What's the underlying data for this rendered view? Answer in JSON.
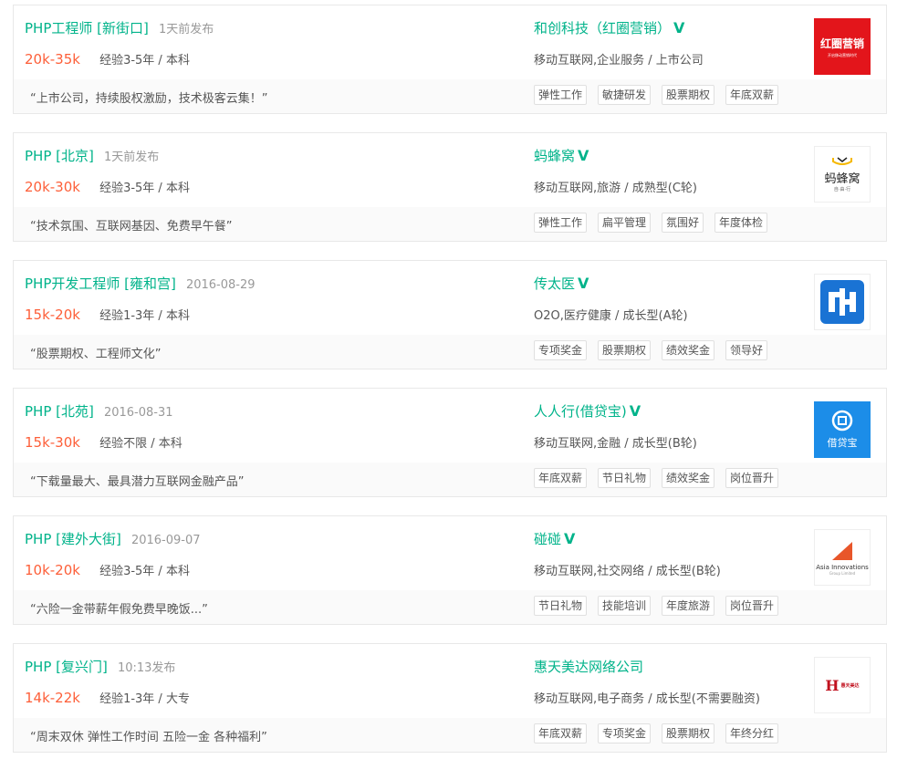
{
  "jobs": [
    {
      "position": "PHP工程师 [新街口]",
      "time": "1天前发布",
      "salary": "20k-35k",
      "requirement": "经验3-5年 / 本科",
      "company": "和创科技（红圈营销）",
      "industry": "移动互联网,企业服务 / 上市公司",
      "slogan": "“上市公司，持续股权激励，技术极客云集！”",
      "tags": [
        "弹性工作",
        "敏捷研发",
        "股票期权",
        "年底双薪"
      ],
      "logo": {
        "text": "红圈营销",
        "subtext": "开启移动营销时代",
        "icon": "hongquan-logo-icon"
      }
    },
    {
      "position": "PHP [北京]",
      "time": "1天前发布",
      "salary": "20k-30k",
      "requirement": "经验3-5年 / 本科",
      "company": "蚂蜂窝",
      "industry": "移动互联网,旅游 / 成熟型(C轮)",
      "slogan": "“技术氛围、互联网基因、免费早午餐”",
      "tags": [
        "弹性工作",
        "扁平管理",
        "氛围好",
        "年度体检"
      ],
      "logo": {
        "text": "蚂蜂窝",
        "subtext": "自·由·行",
        "icon": "mafengwo-logo-icon"
      }
    },
    {
      "position": "PHP开发工程师 [雍和宫]",
      "time": "2016-08-29",
      "salary": "15k-20k",
      "requirement": "经验1-3年 / 本科",
      "company": "传太医",
      "industry": "O2O,医疗健康 / 成长型(A轮)",
      "slogan": "“股票期权、工程师文化”",
      "tags": [
        "专项奖金",
        "股票期权",
        "绩效奖金",
        "领导好"
      ],
      "logo": {
        "text": "",
        "subtext": "",
        "icon": "chuantaiyi-logo-icon"
      }
    },
    {
      "position": "PHP [北苑]",
      "time": "2016-08-31",
      "salary": "15k-30k",
      "requirement": "经验不限 / 本科",
      "company": "人人行(借贷宝)",
      "industry": "移动互联网,金融 / 成长型(B轮)",
      "slogan": "“下载量最大、最具潜力互联网金融产品”",
      "tags": [
        "年底双薪",
        "节日礼物",
        "绩效奖金",
        "岗位晋升"
      ],
      "logo": {
        "text": "借贷宝",
        "subtext": "",
        "icon": "jiedaibao-logo-icon"
      }
    },
    {
      "position": "PHP [建外大街]",
      "time": "2016-09-07",
      "salary": "10k-20k",
      "requirement": "经验3-5年 / 本科",
      "company": "碰碰",
      "industry": "移动互联网,社交网络 / 成长型(B轮)",
      "slogan": "“六险一金带薪年假免费早晚饭...”",
      "tags": [
        "节日礼物",
        "技能培训",
        "年度旅游",
        "岗位晋升"
      ],
      "logo": {
        "text": "Asia Innovations",
        "subtext": "Group Limited",
        "icon": "asia-innovations-logo-icon"
      }
    },
    {
      "position": "PHP [复兴门]",
      "time": "10:13发布",
      "salary": "14k-22k",
      "requirement": "经验1-3年 / 大专",
      "company": "惠天美达网络公司",
      "industry": "移动互联网,电子商务 / 成长型(不需要融资)",
      "slogan": "“周末双休 弹性工作时间 五险一金 各种福利”",
      "tags": [
        "年底双薪",
        "专项奖金",
        "股票期权",
        "年终分红"
      ],
      "logo": {
        "text": "惠天美达",
        "subtext": "",
        "icon": "huitianmeida-logo-icon"
      }
    }
  ],
  "verified_icon": "verified-v-icon",
  "colors": {
    "accent": "#00b38a",
    "salary": "#fd5f39",
    "border": "#e8e8e8",
    "footer_bg": "#fafafa"
  }
}
